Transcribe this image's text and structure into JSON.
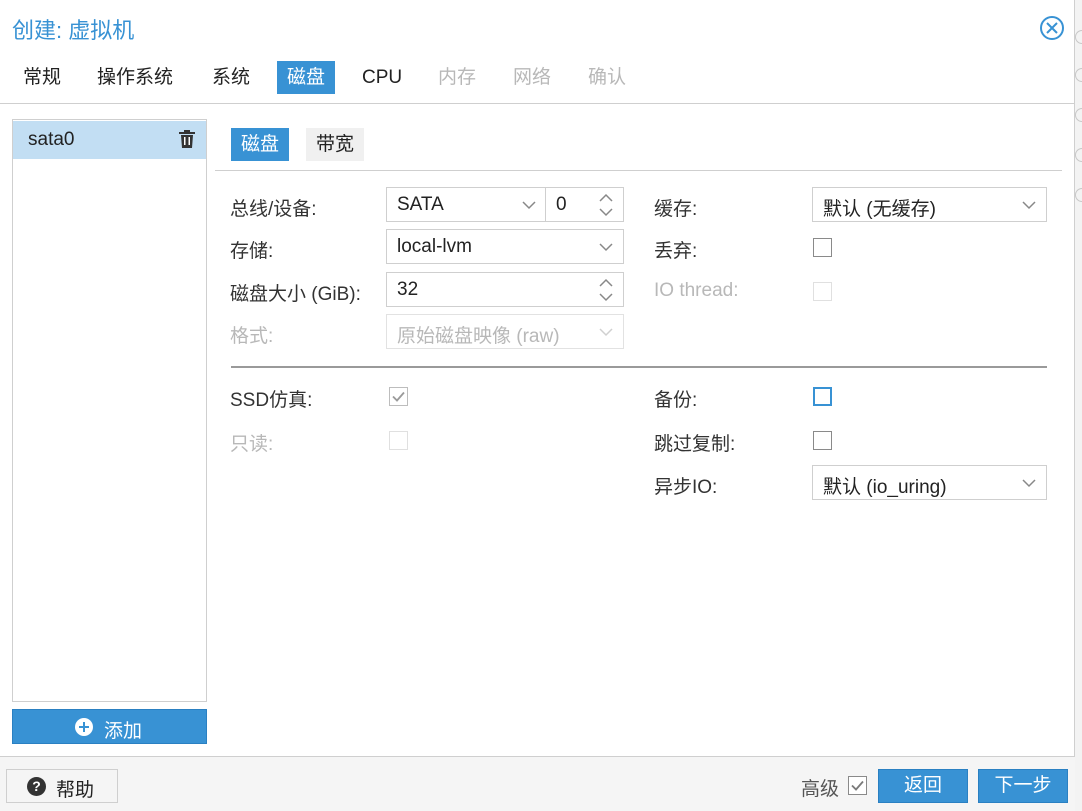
{
  "window": {
    "title": "创建: 虚拟机"
  },
  "tabs": [
    {
      "label": "常规",
      "state": "normal"
    },
    {
      "label": "操作系统",
      "state": "normal"
    },
    {
      "label": "系统",
      "state": "normal"
    },
    {
      "label": "磁盘",
      "state": "active"
    },
    {
      "label": "CPU",
      "state": "normal"
    },
    {
      "label": "内存",
      "state": "disabled"
    },
    {
      "label": "网络",
      "state": "disabled"
    },
    {
      "label": "确认",
      "state": "disabled"
    }
  ],
  "disk_list": {
    "items": [
      {
        "label": "sata0"
      }
    ],
    "add_label": "添加"
  },
  "subtabs": {
    "disk": "磁盘",
    "bandwidth": "带宽"
  },
  "form": {
    "bus_label": "总线/设备:",
    "bus_value": "SATA",
    "device_value": "0",
    "storage_label": "存储:",
    "storage_value": "local-lvm",
    "size_label": "磁盘大小 (GiB):",
    "size_value": "32",
    "format_label": "格式:",
    "format_value": "原始磁盘映像 (raw)",
    "cache_label": "缓存:",
    "cache_value": "默认 (无缓存)",
    "discard_label": "丢弃:",
    "discard_checked": false,
    "iothread_label": "IO thread:",
    "iothread_checked": false,
    "ssd_label": "SSD仿真:",
    "ssd_checked": true,
    "readonly_label": "只读:",
    "readonly_checked": false,
    "backup_label": "备份:",
    "backup_checked": false,
    "skip_replication_label": "跳过复制:",
    "skip_replication_checked": false,
    "async_io_label": "异步IO:",
    "async_io_value": "默认 (io_uring)"
  },
  "footer": {
    "help_label": "帮助",
    "advanced_label": "高级",
    "advanced_checked": true,
    "back_label": "返回",
    "next_label": "下一步"
  },
  "colors": {
    "accent": "#3892d4",
    "selected_row": "#c2def3",
    "disabled_text": "#b8b8b8"
  },
  "icons": {
    "close": "close-circle-icon",
    "trash": "trash-icon",
    "add": "plus-circle-icon",
    "help": "question-circle-icon",
    "dropdown": "chevron-down-icon",
    "spinner": "spinner-arrows-icon",
    "check": "checkmark-icon"
  }
}
